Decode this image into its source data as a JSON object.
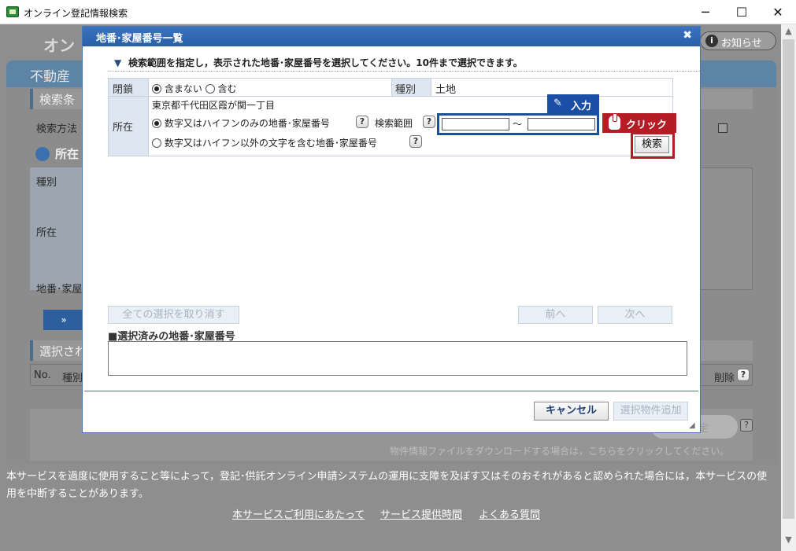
{
  "window": {
    "title": "オンライン登記情報検索",
    "minimize": "─",
    "maximize": "☐",
    "close": "✕"
  },
  "background": {
    "header_title": "オン",
    "notice_label": "お知らせ",
    "band_title": "不動産",
    "section1": "検索条",
    "search_method": "検索方法",
    "section2": "所在",
    "col_kind": "種別",
    "col_location": "所在",
    "col_lot": "地番･家屋",
    "arrow_btn": "»",
    "section3": "選択され",
    "col_no": "No.",
    "col_kind2": "種別",
    "col_delete": "削除",
    "confirm_btn": "定",
    "download_text": "物件情報ファイルをダウンロードする場合は，こちらをクリックしてください。"
  },
  "footer": {
    "notice": "本サービスを過度に使用すること等によって，登記･供託オンライン申請システムの運用に支障を及ぼす又はそのおそれがあると認められた場合には，本サービスの使用を中断することがあります。",
    "links": [
      "本サービスご利用にあたって",
      "サービス提供時間",
      "よくある質問"
    ]
  },
  "dialog": {
    "title": "地番･家屋番号一覧",
    "close": "✖",
    "instruction": "検索範囲を指定し，表示された地番･家屋番号を選択してください。10件まで選択できます。",
    "closed_label": "閉鎖",
    "closed_options": [
      "含まない",
      "含む"
    ],
    "kind_label": "種別",
    "kind_value": "土地",
    "location_label": "所在",
    "location_value": "東京都千代田区霞が関一丁目",
    "option_numeric": "数字又はハイフンのみの地番･家屋番号",
    "range_label": "検索範囲",
    "range_from": "",
    "range_to": "",
    "tilde": "～",
    "option_other": "数字又はハイフン以外の文字を含む地番･家屋番号",
    "search_button": "検索",
    "tag_input": "入力",
    "tag_click": "クリック",
    "clear_all_button": "全ての選択を取り消す",
    "prev_button": "前へ",
    "next_button": "次へ",
    "selected_label": "■選択済みの地番･家屋番号",
    "cancel_button": "キャンセル",
    "add_button": "選択物件追加"
  },
  "colors": {
    "dialog_title_bg": "#2a5fa8",
    "input_tag": "#1b4fa5",
    "click_tag": "#b51c26"
  },
  "icons": {
    "help": "?",
    "info": "i",
    "pen": "✎"
  }
}
